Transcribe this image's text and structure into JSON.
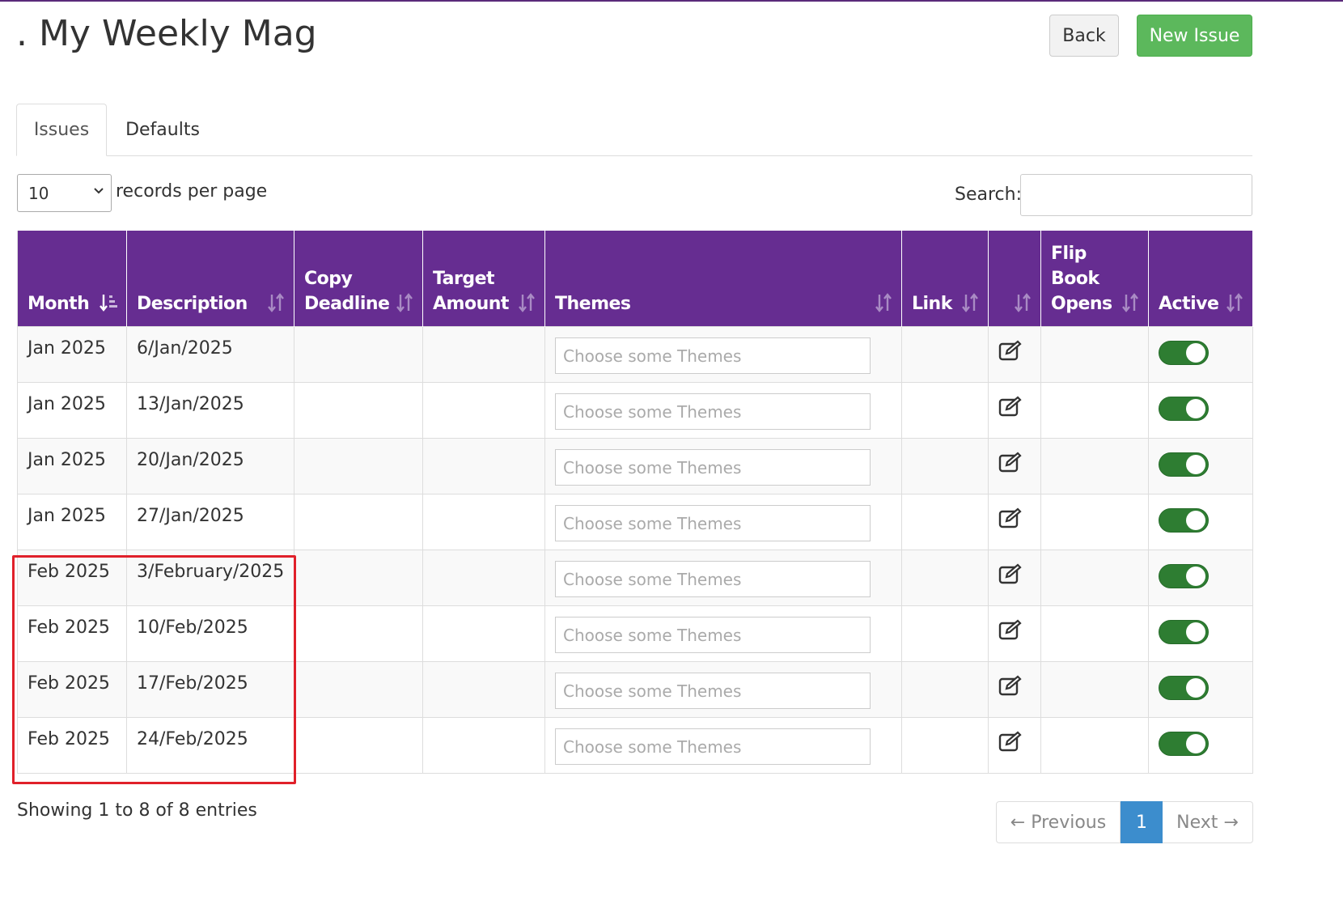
{
  "header": {
    "title": ". My Weekly Mag",
    "back_label": "Back",
    "new_issue_label": "New Issue"
  },
  "tabs": [
    {
      "label": "Issues",
      "active": true
    },
    {
      "label": "Defaults",
      "active": false
    }
  ],
  "length": {
    "value": "10",
    "label": "records per page"
  },
  "search": {
    "label": "Search:",
    "value": ""
  },
  "table": {
    "columns": [
      {
        "label": "Month",
        "sort": "ascending"
      },
      {
        "label": "Description",
        "sort": "none"
      },
      {
        "label": "Copy Deadline",
        "sort": "none"
      },
      {
        "label": "Target Amount",
        "sort": "none"
      },
      {
        "label": "Themes",
        "sort": "none"
      },
      {
        "label": "Link",
        "sort": "none"
      },
      {
        "label": "",
        "sort": "none"
      },
      {
        "label": "Flip Book Opens",
        "sort": "none"
      },
      {
        "label": "Active",
        "sort": "none"
      }
    ],
    "themes_placeholder": "Choose some Themes",
    "rows": [
      {
        "month": "Jan 2025",
        "description": "6/Jan/2025",
        "copy_deadline": "",
        "target_amount": "",
        "link": "",
        "flip_book_opens": "",
        "active": true
      },
      {
        "month": "Jan 2025",
        "description": "13/Jan/2025",
        "copy_deadline": "",
        "target_amount": "",
        "link": "",
        "flip_book_opens": "",
        "active": true
      },
      {
        "month": "Jan 2025",
        "description": "20/Jan/2025",
        "copy_deadline": "",
        "target_amount": "",
        "link": "",
        "flip_book_opens": "",
        "active": true
      },
      {
        "month": "Jan 2025",
        "description": "27/Jan/2025",
        "copy_deadline": "",
        "target_amount": "",
        "link": "",
        "flip_book_opens": "",
        "active": true
      },
      {
        "month": "Feb 2025",
        "description": "3/February/2025",
        "copy_deadline": "",
        "target_amount": "",
        "link": "",
        "flip_book_opens": "",
        "active": true
      },
      {
        "month": "Feb 2025",
        "description": "10/Feb/2025",
        "copy_deadline": "",
        "target_amount": "",
        "link": "",
        "flip_book_opens": "",
        "active": true
      },
      {
        "month": "Feb 2025",
        "description": "17/Feb/2025",
        "copy_deadline": "",
        "target_amount": "",
        "link": "",
        "flip_book_opens": "",
        "active": true
      },
      {
        "month": "Feb 2025",
        "description": "24/Feb/2025",
        "copy_deadline": "",
        "target_amount": "",
        "link": "",
        "flip_book_opens": "",
        "active": true
      }
    ]
  },
  "footer": {
    "info": "Showing 1 to 8 of 8 entries",
    "previous_label": "← Previous",
    "current_page": "1",
    "next_label": "Next →"
  },
  "icons": {
    "sort": "sort-arrows-icon",
    "sort_asc": "sort-ascending-icon",
    "edit": "edit-icon",
    "chevron": "chevron-down-icon"
  },
  "colors": {
    "header_bg": "#662d91",
    "new_issue_bg": "#5cb85c",
    "toggle_on": "#2e7d32",
    "pager_active": "#3c8dcd",
    "highlight": "#e0202a"
  }
}
